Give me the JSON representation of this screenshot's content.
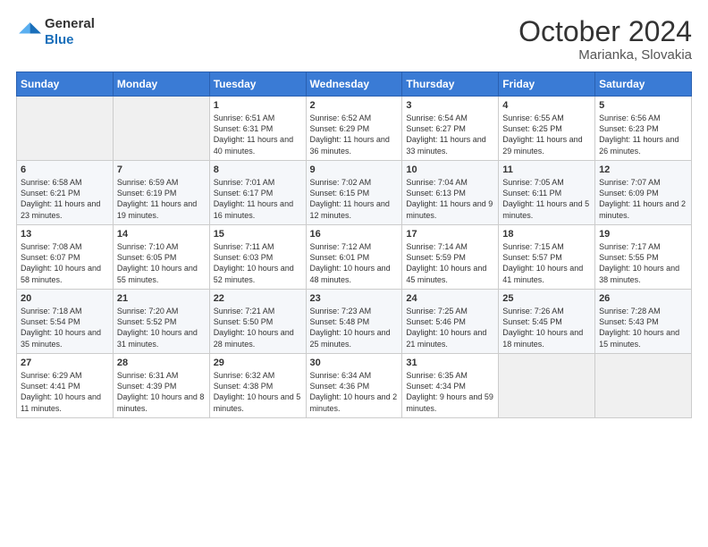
{
  "logo": {
    "line1": "General",
    "line2": "Blue"
  },
  "title": "October 2024",
  "subtitle": "Marianka, Slovakia",
  "header_days": [
    "Sunday",
    "Monday",
    "Tuesday",
    "Wednesday",
    "Thursday",
    "Friday",
    "Saturday"
  ],
  "weeks": [
    [
      {
        "day": "",
        "content": ""
      },
      {
        "day": "",
        "content": ""
      },
      {
        "day": "1",
        "content": "Sunrise: 6:51 AM\nSunset: 6:31 PM\nDaylight: 11 hours and 40 minutes."
      },
      {
        "day": "2",
        "content": "Sunrise: 6:52 AM\nSunset: 6:29 PM\nDaylight: 11 hours and 36 minutes."
      },
      {
        "day": "3",
        "content": "Sunrise: 6:54 AM\nSunset: 6:27 PM\nDaylight: 11 hours and 33 minutes."
      },
      {
        "day": "4",
        "content": "Sunrise: 6:55 AM\nSunset: 6:25 PM\nDaylight: 11 hours and 29 minutes."
      },
      {
        "day": "5",
        "content": "Sunrise: 6:56 AM\nSunset: 6:23 PM\nDaylight: 11 hours and 26 minutes."
      }
    ],
    [
      {
        "day": "6",
        "content": "Sunrise: 6:58 AM\nSunset: 6:21 PM\nDaylight: 11 hours and 23 minutes."
      },
      {
        "day": "7",
        "content": "Sunrise: 6:59 AM\nSunset: 6:19 PM\nDaylight: 11 hours and 19 minutes."
      },
      {
        "day": "8",
        "content": "Sunrise: 7:01 AM\nSunset: 6:17 PM\nDaylight: 11 hours and 16 minutes."
      },
      {
        "day": "9",
        "content": "Sunrise: 7:02 AM\nSunset: 6:15 PM\nDaylight: 11 hours and 12 minutes."
      },
      {
        "day": "10",
        "content": "Sunrise: 7:04 AM\nSunset: 6:13 PM\nDaylight: 11 hours and 9 minutes."
      },
      {
        "day": "11",
        "content": "Sunrise: 7:05 AM\nSunset: 6:11 PM\nDaylight: 11 hours and 5 minutes."
      },
      {
        "day": "12",
        "content": "Sunrise: 7:07 AM\nSunset: 6:09 PM\nDaylight: 11 hours and 2 minutes."
      }
    ],
    [
      {
        "day": "13",
        "content": "Sunrise: 7:08 AM\nSunset: 6:07 PM\nDaylight: 10 hours and 58 minutes."
      },
      {
        "day": "14",
        "content": "Sunrise: 7:10 AM\nSunset: 6:05 PM\nDaylight: 10 hours and 55 minutes."
      },
      {
        "day": "15",
        "content": "Sunrise: 7:11 AM\nSunset: 6:03 PM\nDaylight: 10 hours and 52 minutes."
      },
      {
        "day": "16",
        "content": "Sunrise: 7:12 AM\nSunset: 6:01 PM\nDaylight: 10 hours and 48 minutes."
      },
      {
        "day": "17",
        "content": "Sunrise: 7:14 AM\nSunset: 5:59 PM\nDaylight: 10 hours and 45 minutes."
      },
      {
        "day": "18",
        "content": "Sunrise: 7:15 AM\nSunset: 5:57 PM\nDaylight: 10 hours and 41 minutes."
      },
      {
        "day": "19",
        "content": "Sunrise: 7:17 AM\nSunset: 5:55 PM\nDaylight: 10 hours and 38 minutes."
      }
    ],
    [
      {
        "day": "20",
        "content": "Sunrise: 7:18 AM\nSunset: 5:54 PM\nDaylight: 10 hours and 35 minutes."
      },
      {
        "day": "21",
        "content": "Sunrise: 7:20 AM\nSunset: 5:52 PM\nDaylight: 10 hours and 31 minutes."
      },
      {
        "day": "22",
        "content": "Sunrise: 7:21 AM\nSunset: 5:50 PM\nDaylight: 10 hours and 28 minutes."
      },
      {
        "day": "23",
        "content": "Sunrise: 7:23 AM\nSunset: 5:48 PM\nDaylight: 10 hours and 25 minutes."
      },
      {
        "day": "24",
        "content": "Sunrise: 7:25 AM\nSunset: 5:46 PM\nDaylight: 10 hours and 21 minutes."
      },
      {
        "day": "25",
        "content": "Sunrise: 7:26 AM\nSunset: 5:45 PM\nDaylight: 10 hours and 18 minutes."
      },
      {
        "day": "26",
        "content": "Sunrise: 7:28 AM\nSunset: 5:43 PM\nDaylight: 10 hours and 15 minutes."
      }
    ],
    [
      {
        "day": "27",
        "content": "Sunrise: 6:29 AM\nSunset: 4:41 PM\nDaylight: 10 hours and 11 minutes."
      },
      {
        "day": "28",
        "content": "Sunrise: 6:31 AM\nSunset: 4:39 PM\nDaylight: 10 hours and 8 minutes."
      },
      {
        "day": "29",
        "content": "Sunrise: 6:32 AM\nSunset: 4:38 PM\nDaylight: 10 hours and 5 minutes."
      },
      {
        "day": "30",
        "content": "Sunrise: 6:34 AM\nSunset: 4:36 PM\nDaylight: 10 hours and 2 minutes."
      },
      {
        "day": "31",
        "content": "Sunrise: 6:35 AM\nSunset: 4:34 PM\nDaylight: 9 hours and 59 minutes."
      },
      {
        "day": "",
        "content": ""
      },
      {
        "day": "",
        "content": ""
      }
    ]
  ]
}
